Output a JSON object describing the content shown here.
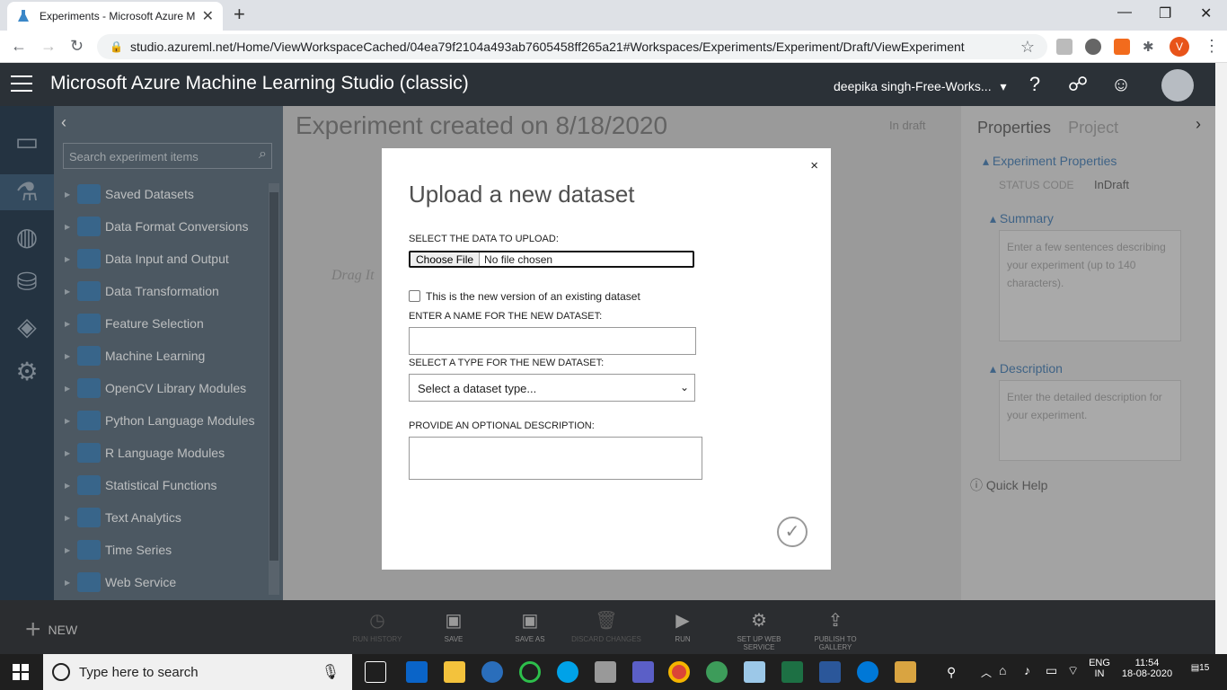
{
  "browser": {
    "tab_title": "Experiments - Microsoft Azure M",
    "url": "studio.azureml.net/Home/ViewWorkspaceCached/04ea79f2104a493ab7605458ff265a21#Workspaces/Experiments/Experiment/Draft/ViewExperiment",
    "profile_initial": "V"
  },
  "header": {
    "app_title": "Microsoft Azure Machine Learning Studio (classic)",
    "workspace": "deepika singh-Free-Works...",
    "workspace_caret": "▾"
  },
  "palette": {
    "search_placeholder": "Search experiment items",
    "items": [
      {
        "label": "Saved Datasets"
      },
      {
        "label": "Data Format Conversions"
      },
      {
        "label": "Data Input and Output"
      },
      {
        "label": "Data Transformation"
      },
      {
        "label": "Feature Selection"
      },
      {
        "label": "Machine Learning"
      },
      {
        "label": "OpenCV Library Modules"
      },
      {
        "label": "Python Language Modules"
      },
      {
        "label": "R Language Modules"
      },
      {
        "label": "Statistical Functions"
      },
      {
        "label": "Text Analytics"
      },
      {
        "label": "Time Series"
      },
      {
        "label": "Web Service"
      }
    ]
  },
  "canvas": {
    "title": "Experiment created on 8/18/2020",
    "status": "In draft",
    "drag_hint": "Drag It"
  },
  "properties": {
    "tab_properties": "Properties",
    "tab_project": "Project",
    "section_experiment": "Experiment Properties",
    "status_code_label": "STATUS CODE",
    "status_code_value": "InDraft",
    "section_summary": "Summary",
    "summary_placeholder": "Enter a few sentences describing your experiment (up to 140 characters).",
    "section_description": "Description",
    "description_placeholder": "Enter the detailed description for your experiment.",
    "quick_help": "Quick Help"
  },
  "commands": {
    "new_label": "NEW",
    "items": [
      {
        "label": "RUN HISTORY"
      },
      {
        "label": "SAVE"
      },
      {
        "label": "SAVE AS"
      },
      {
        "label": "DISCARD CHANGES"
      },
      {
        "label": "RUN"
      },
      {
        "label": "SET UP WEB SERVICE"
      },
      {
        "label": "PUBLISH TO GALLERY"
      }
    ]
  },
  "dialog": {
    "title": "Upload a new dataset",
    "close": "×",
    "select_data_label": "SELECT THE DATA TO UPLOAD:",
    "choose_file": "Choose File",
    "no_file": "No file chosen",
    "new_version_label": "This is the new version of an existing dataset",
    "name_label": "ENTER A NAME FOR THE NEW DATASET:",
    "type_label": "SELECT A TYPE FOR THE NEW DATASET:",
    "type_selected": "Select a dataset type...",
    "description_label": "PROVIDE AN OPTIONAL DESCRIPTION:"
  },
  "taskbar": {
    "search_text": "Type here to search",
    "lang_top": "ENG",
    "lang_bottom": "IN",
    "time": "11:54",
    "date": "18-08-2020",
    "notif_count": "15"
  }
}
